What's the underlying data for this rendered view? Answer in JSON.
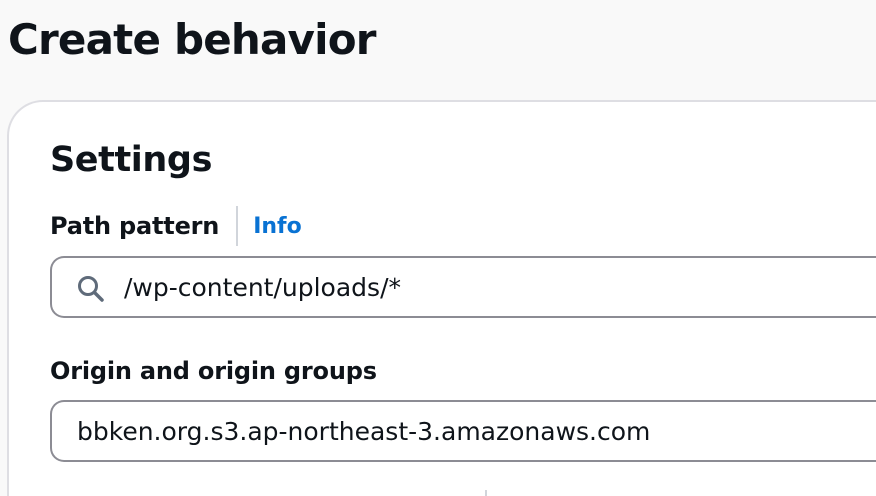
{
  "page": {
    "title": "Create behavior"
  },
  "settings": {
    "title": "Settings",
    "path_pattern": {
      "label": "Path pattern",
      "info_label": "Info",
      "value": "/wp-content/uploads/*",
      "icon": "search-icon"
    },
    "origin": {
      "label": "Origin and origin groups",
      "value": "bbken.org.s3.ap-northeast-3.amazonaws.com"
    }
  },
  "colors": {
    "link": "#0972d3",
    "text": "#0f141a",
    "input_border": "#8c8c94",
    "panel_border": "#dedee3",
    "background": "#f9f9f9"
  }
}
